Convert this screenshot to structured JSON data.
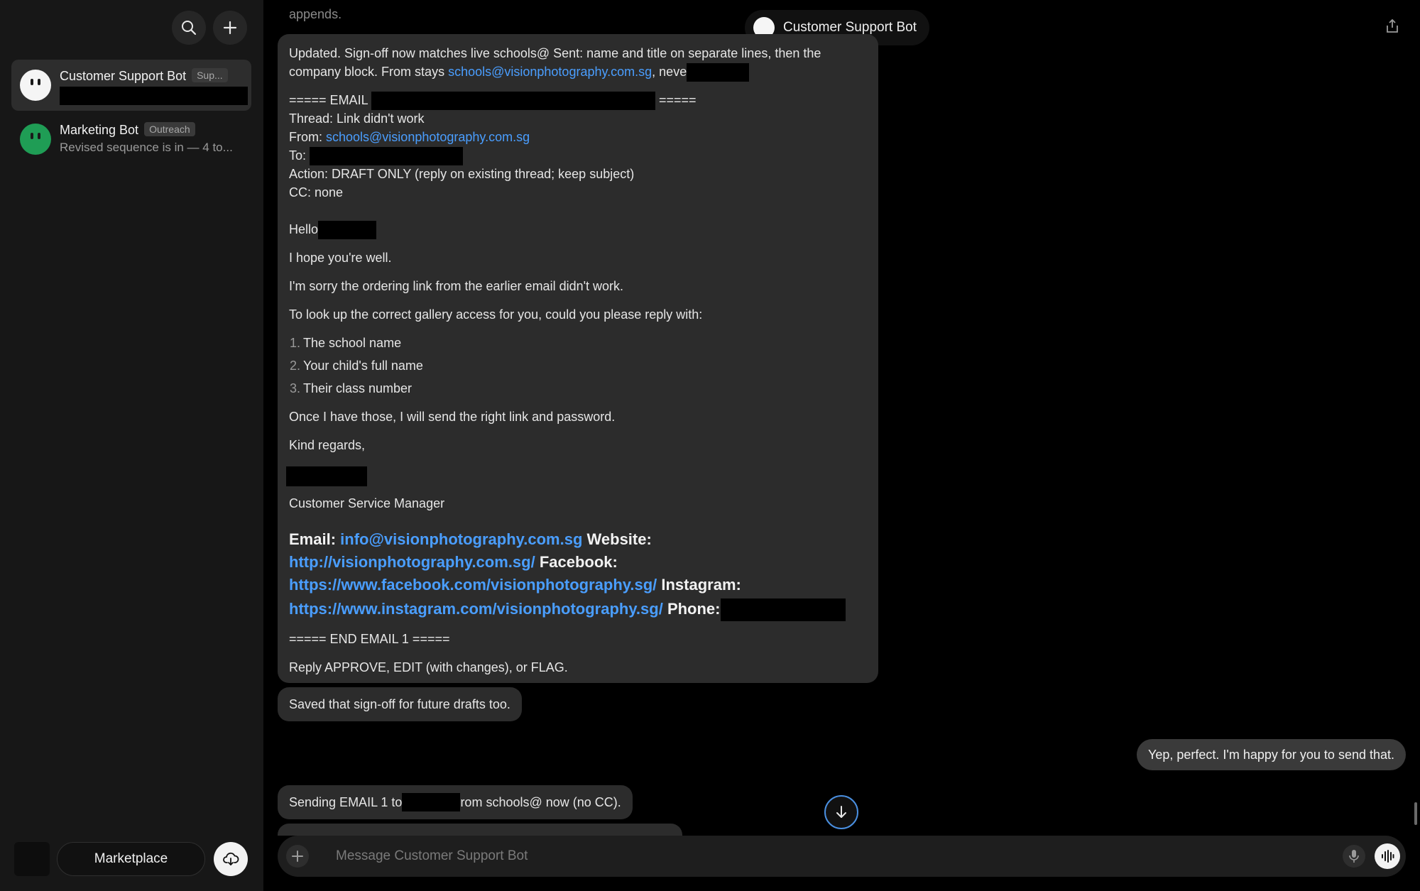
{
  "sidebar": {
    "chats": [
      {
        "name": "Customer Support Bot",
        "tag": "Sup...",
        "preview": ""
      },
      {
        "name": "Marketing Bot",
        "tag": "Outreach",
        "preview": "Revised sequence is in — 4 to..."
      }
    ],
    "marketplace_label": "Marketplace"
  },
  "header": {
    "title": "Customer Support Bot"
  },
  "messages": {
    "top_fragment": "appends.",
    "bot_reply": {
      "intro_1": "Updated. Sign-off now matches live schools@ Sent: name and title on separate lines, then the",
      "intro_2_pre": "company block. From stays ",
      "intro_2_link": "schools@visionphotography.com.sg",
      "intro_2_post": ", neve",
      "email_header_pre": "===== EMAIL ",
      "email_header_post": "=====",
      "thread": "Thread: Link didn't work",
      "from_label": "From: ",
      "from_link": "schools@visionphotography.com.sg",
      "to_label": "To:",
      "action": "Action: DRAFT ONLY (reply on existing thread; keep subject)",
      "cc": "CC: none",
      "hello": "Hello",
      "hope": "I hope you're well.",
      "sorry": "I'm sorry the ordering link from the earlier email didn't work.",
      "lookup": "To look up the correct gallery access for you, could you please reply with:",
      "list": [
        {
          "num": "1.",
          "text": "The school name"
        },
        {
          "num": "2.",
          "text": "Your child's full name"
        },
        {
          "num": "3.",
          "text": "Their class number"
        }
      ],
      "once": "Once I have those, I will send the right link and password.",
      "regards": "Kind regards,",
      "title": "Customer Service Manager",
      "sig": {
        "email_label": "Email: ",
        "email_link": "info@visionphotography.com.sg",
        "website_label": " Website:",
        "website_link": "http://visionphotography.com.sg/",
        "facebook_label": " Facebook:",
        "facebook_link": "https://www.facebook.com/visionphotography.sg/",
        "instagram_label": " Instagram:",
        "instagram_link": "https://www.instagram.com/visionphotography.sg/",
        "phone_label": " Phone:"
      },
      "end": "===== END EMAIL 1 =====",
      "prompt": "Reply APPROVE, EDIT (with changes), or FLAG."
    },
    "saved": "Saved that sign-off for future drafts too.",
    "user": "Yep, perfect. I'm happy for you to send that.",
    "sending_pre": "Sending EMAIL 1 to ",
    "sending_post": "rom schools@ now (no CC)."
  },
  "composer": {
    "placeholder": "Message Customer Support Bot"
  },
  "colors": {
    "link": "#4a9eff",
    "bubble": "#2c2c2c",
    "marketing_avatar": "#1f9d55"
  }
}
